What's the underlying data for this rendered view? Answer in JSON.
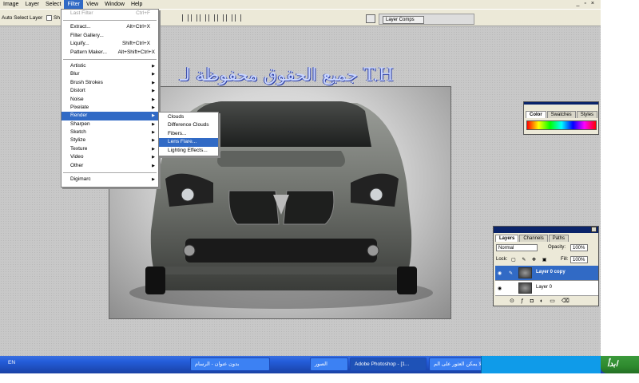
{
  "menubar": {
    "items": [
      "Image",
      "Layer",
      "Select",
      "Filter",
      "View",
      "Window",
      "Help"
    ],
    "active": "Filter",
    "controls": [
      "_",
      "▫",
      "×"
    ]
  },
  "options": {
    "auto_select_label": "Auto Select Layer",
    "show_label": "Sh",
    "dock_tab": "Layer Comps"
  },
  "filter_menu": {
    "top": [
      {
        "label": "Last Filter",
        "shortcut": "Ctrl+F",
        "disabled": true
      },
      {
        "label": "Extract...",
        "shortcut": "Alt+Ctrl+X"
      },
      {
        "label": "Filter Gallery..."
      },
      {
        "label": "Liquify...",
        "shortcut": "Shift+Ctrl+X"
      },
      {
        "label": "Pattern Maker...",
        "shortcut": "Alt+Shift+Ctrl+X"
      }
    ],
    "groups": [
      "Artistic",
      "Blur",
      "Brush Strokes",
      "Distort",
      "Noise",
      "Pixelate",
      "Render",
      "Sharpen",
      "Sketch",
      "Stylize",
      "Texture",
      "Video",
      "Other"
    ],
    "highlighted_group": "Render",
    "bottom": [
      "Digimarc"
    ]
  },
  "render_submenu": {
    "items": [
      "Clouds",
      "Difference Clouds",
      "Fibers...",
      "Lens Flare...",
      "Lighting Effects..."
    ],
    "highlighted": "Lens Flare..."
  },
  "canvas": {
    "watermark": "جميع الحقوق محفوظة لـ T.H"
  },
  "color_panel": {
    "tabs": [
      "Color",
      "Swatches",
      "Styles"
    ],
    "active_tab": "Color"
  },
  "layers_panel": {
    "tabs": [
      "Layers",
      "Channels",
      "Paths"
    ],
    "active_tab": "Layers",
    "blend_mode": "Normal",
    "opacity_label": "Opacity:",
    "opacity_value": "100%",
    "lock_label": "Lock:",
    "fill_label": "Fill:",
    "fill_value": "100%",
    "layers": [
      {
        "name": "Layer 0 copy",
        "selected": true
      },
      {
        "name": "Layer 0",
        "selected": false
      }
    ]
  },
  "taskbar": {
    "lang": "EN",
    "tasks": [
      "بدون عنوان - الرسام",
      "الصور",
      "Adobe Photoshop - [1...",
      "لا يمكن العثور على الم..."
    ],
    "active_task": "Adobe Photoshop - [1...",
    "start_label": "ابدأ"
  },
  "colors": {
    "highlight": "#316ac5",
    "taskbar": "#245edb",
    "start": "#2e8a2e",
    "tray": "#0f9be9"
  }
}
